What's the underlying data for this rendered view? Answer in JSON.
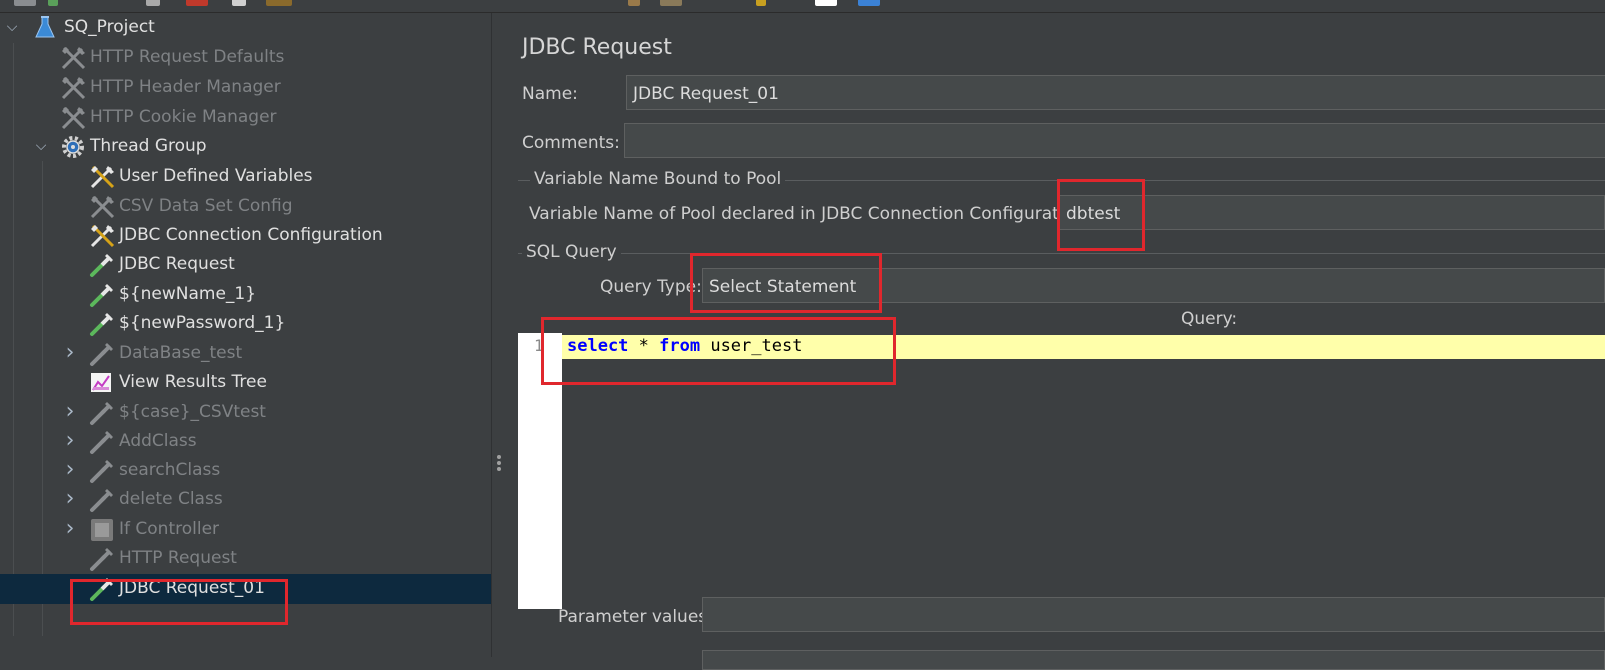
{
  "tree": {
    "root": {
      "label": "SQ_Project",
      "icon": "flask-icon"
    },
    "items": [
      {
        "label": "HTTP Request Defaults",
        "icon": "config-tool-icon",
        "enabled": false
      },
      {
        "label": "HTTP Header Manager",
        "icon": "config-tool-icon",
        "enabled": false
      },
      {
        "label": "HTTP Cookie Manager",
        "icon": "config-tool-icon",
        "enabled": false
      },
      {
        "label": "Thread Group",
        "icon": "gear-icon",
        "enabled": true
      },
      {
        "label": "User Defined Variables",
        "icon": "config-tool-icon",
        "enabled": true
      },
      {
        "label": "CSV Data Set Config",
        "icon": "config-tool-icon",
        "enabled": false
      },
      {
        "label": "JDBC Connection Configuration",
        "icon": "config-tool-icon",
        "enabled": true
      },
      {
        "label": "JDBC Request",
        "icon": "pipette-icon",
        "enabled": true
      },
      {
        "label": "${newName_1}",
        "icon": "pipette-icon",
        "enabled": true
      },
      {
        "label": "${newPassword_1}",
        "icon": "pipette-icon",
        "enabled": true
      },
      {
        "label": "DataBase_test",
        "icon": "pipette-icon",
        "enabled": false
      },
      {
        "label": "View Results Tree",
        "icon": "graph-icon",
        "enabled": true
      },
      {
        "label": "${case}_CSVtest",
        "icon": "pipette-icon",
        "enabled": false
      },
      {
        "label": "AddClass",
        "icon": "pipette-icon",
        "enabled": false
      },
      {
        "label": "searchClass",
        "icon": "pipette-icon",
        "enabled": false
      },
      {
        "label": "delete Class",
        "icon": "pipette-icon",
        "enabled": false
      },
      {
        "label": "If Controller",
        "icon": "controller-icon",
        "enabled": false
      },
      {
        "label": "HTTP Request",
        "icon": "pipette-icon",
        "enabled": false
      },
      {
        "label": "JDBC Request_01",
        "icon": "pipette-icon",
        "enabled": true,
        "selected": true
      }
    ]
  },
  "panel": {
    "title": "JDBC Request",
    "name_label": "Name:",
    "name_value": "JDBC Request_01",
    "comments_label": "Comments:",
    "comments_value": "",
    "pool_section": "Variable Name Bound to Pool",
    "pool_label": "Variable Name of Pool declared in JDBC Connection Configuration:",
    "pool_value": "dbtest",
    "sql_section": "SQL Query",
    "query_type_label": "Query Type:",
    "query_type_value": "Select Statement",
    "query_label": "Query:",
    "query_line_number": "1",
    "query_tokens": [
      {
        "text": "select",
        "kw": true
      },
      {
        "text": " * ",
        "kw": false
      },
      {
        "text": "from",
        "kw": true
      },
      {
        "text": " user_test",
        "kw": false
      }
    ],
    "param_label": "Parameter values:",
    "param_value": ""
  },
  "colors": {
    "background": "#3c3f41",
    "selection": "#0d293e",
    "highlight_box": "#e0272d",
    "current_line": "#ffffaa",
    "sql_keyword": "#0000ff"
  }
}
